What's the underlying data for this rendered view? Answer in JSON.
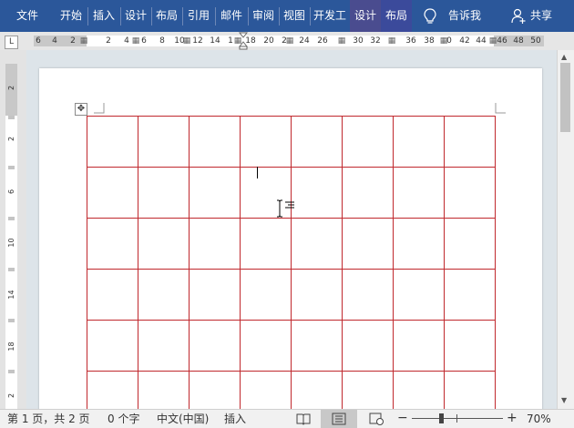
{
  "ribbon": {
    "tabs": [
      {
        "label": "文件"
      },
      {
        "label": "开始"
      },
      {
        "label": "插入"
      },
      {
        "label": "设计"
      },
      {
        "label": "布局"
      },
      {
        "label": "引用"
      },
      {
        "label": "邮件"
      },
      {
        "label": "审阅"
      },
      {
        "label": "视图"
      },
      {
        "label": "开发工"
      },
      {
        "label": "设计"
      },
      {
        "label": "布局"
      }
    ],
    "tell_me": "告诉我",
    "share": "共享",
    "colors": {
      "ribbon": "#2b579a",
      "context_tab": "#3b4a9b"
    }
  },
  "ruler": {
    "corner": "L",
    "h_numbers": [
      "6",
      "4",
      "2",
      "2",
      "4",
      "6",
      "8",
      "10",
      "12",
      "14",
      "1",
      "18",
      "20",
      "2",
      "24",
      "26",
      "30",
      "32",
      "36",
      "38",
      "0",
      "42",
      "44",
      "46",
      "48",
      "50"
    ],
    "v_numbers": [
      "2",
      "2",
      "6",
      "10",
      "14",
      "18",
      "2"
    ]
  },
  "status": {
    "page": "第 1 页，共 2 页",
    "words": "0 个字",
    "language": "中文(中国)",
    "mode": "插入",
    "zoom_minus": "−",
    "zoom_plus": "+",
    "zoom": "70%"
  },
  "table": {
    "rows": 6,
    "cols": 8,
    "border_color": "#c0282d"
  }
}
